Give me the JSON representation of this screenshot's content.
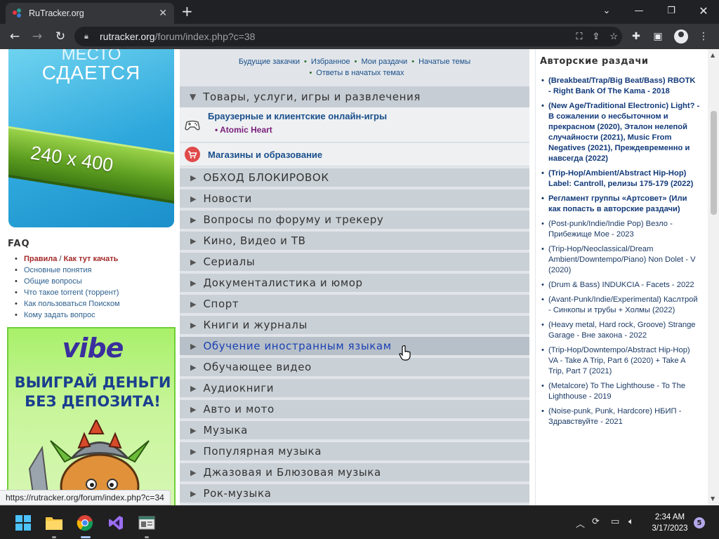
{
  "browser": {
    "tab_title": "RuTracker.org",
    "tab_close": "✕",
    "new_tab": "+",
    "url_host": "rutracker.org",
    "url_path": "/forum/index.php?c=38",
    "status_url": "https://rutracker.org/forum/index.php?c=34"
  },
  "left": {
    "ad_top_text": "МЕСТО",
    "ad_rent_text": "СДАЕТСЯ",
    "ad_size_text": "240 x 400",
    "faq_title": "FAQ",
    "faq_rules": "Правила",
    "faq_sep": "/",
    "faq_howto": "Как тут качать",
    "faq_items": [
      "Основные понятия",
      "Общие вопросы",
      "Что такое torrent (торрент)",
      "Как пользоваться Поиском",
      "Кому задать вопрос"
    ],
    "ad2_brand": "vibe",
    "ad2_line1": "ВЫИГРАЙ ДЕНЬГИ",
    "ad2_line2": "БЕЗ ДЕПОЗИТА!"
  },
  "center": {
    "quicklinks": [
      "Будущие закачки",
      "Избранное",
      "Мои раздачи",
      "Начатые темы"
    ],
    "quicklinks_row2": "Ответы в начатых темах",
    "category_open": "Товары, услуги, игры и развлечения",
    "forum1_name": "Браузерные и клиентские онлайн-игры",
    "forum1_sub": "Atomic Heart",
    "forum2_name": "Магазины и образование",
    "categories": [
      "ОБХОД БЛОКИРОВОК",
      "Новости",
      "Вопросы по форуму и трекеру",
      "Кино, Видео и ТВ",
      "Сериалы",
      "Документалистика и юмор",
      "Спорт",
      "Книги и журналы",
      "Обучение иностранным языкам",
      "Обучающее видео",
      "Аудиокниги",
      "Авто и мото",
      "Музыка",
      "Популярная музыка",
      "Джазовая и Блюзовая музыка",
      "Рок-музыка"
    ]
  },
  "right": {
    "title": "Авторские раздачи",
    "items": [
      "(Breakbeat/Trap/Big Beat/Bass) RBOTK - Right Bank Of The Kama - 2018",
      "(New Age/Traditional Electronic) Light? - В сожалении о несбыточном и прекрасном (2020), Эталон нелепой случайности (2021), Music From Negatives (2021), Преждевременно и навсегда (2022)",
      "(Trip-Hop/Ambient/Abstract Hip-Hop) Label: Cantroll, релизы 175-179 (2022)",
      "Регламент группы «Артсовет» (Или как попасть в авторские раздачи)",
      "(Post-punk/Indie/Indie Pop) Везло - Прибежище Мое - 2023",
      "(Trip-Hop/Neoclassical/Dream Ambient/Downtempo/Piano) Non Dolet - V (2020)",
      "(Drum & Bass) INDUKCIA - Facets - 2022",
      "(Avant-Punk/Indie/Experimental) Каслтрой - Синкопы и трубы + Холмы (2022)",
      "(Heavy metal, Hard rock, Groove) Strange Garage - Вне закона - 2022",
      "(Trip-Hop/Downtempo/Abstract Hip-Hop) VA - Take A Trip, Part 6 (2020) + Take A Trip, Part 7 (2021)",
      "(Metalcore) To The Lighthouse - To The Lighthouse - 2019",
      "(Noise-punk, Punk, Hardcore) НБИП - Здравствуйте - 2021"
    ]
  },
  "taskbar": {
    "time": "2:34 AM",
    "date": "3/17/2023",
    "notifications": "5"
  }
}
